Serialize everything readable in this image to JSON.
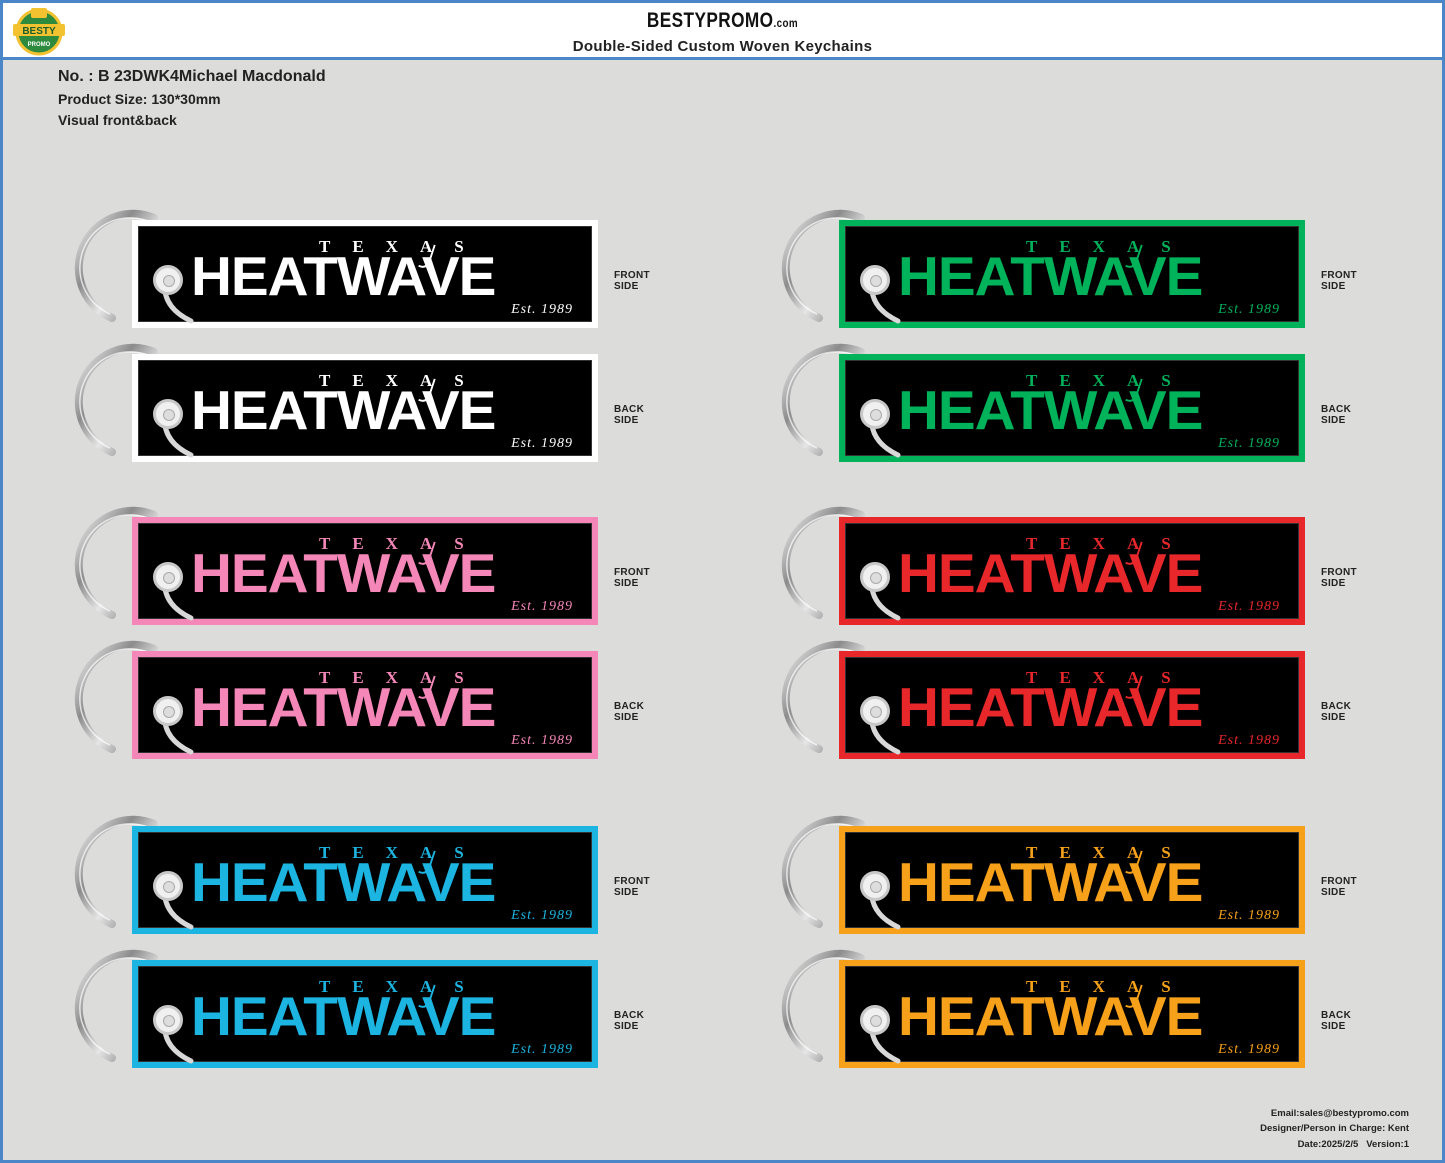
{
  "header": {
    "brand": "BESTYPROMO",
    "brand_suffix": ".com",
    "subtitle": "Double-Sided Custom Woven Keychains",
    "logo_top": "BESTY",
    "logo_bottom": "PROMO"
  },
  "info": {
    "number": "No. : B 23DWK4Michael Macdonald",
    "size": "Product Size: 130*30mm",
    "visual": "Visual front&back"
  },
  "keychain_text": {
    "texas": "TEXAS",
    "heatwave": "HEATWAVE",
    "est": "Est. 1989"
  },
  "labels": {
    "front": "FRONT SIDE",
    "back": "BACK SIDE"
  },
  "variants": [
    {
      "color": "#ffffff",
      "text_color": "#ffffff"
    },
    {
      "color": "#00b259",
      "text_color": "#00b259"
    },
    {
      "color": "#f587b8",
      "text_color": "#f587b8"
    },
    {
      "color": "#e8272a",
      "text_color": "#e8272a"
    },
    {
      "color": "#1cb4e1",
      "text_color": "#1cb4e1"
    },
    {
      "color": "#f7a11a",
      "text_color": "#f7a11a"
    }
  ],
  "footer": {
    "email": "Email:sales@bestypromo.com",
    "designer": "Designer/Person in Charge: Kent",
    "date": "Date:2025/2/5",
    "version": "Version:1"
  }
}
